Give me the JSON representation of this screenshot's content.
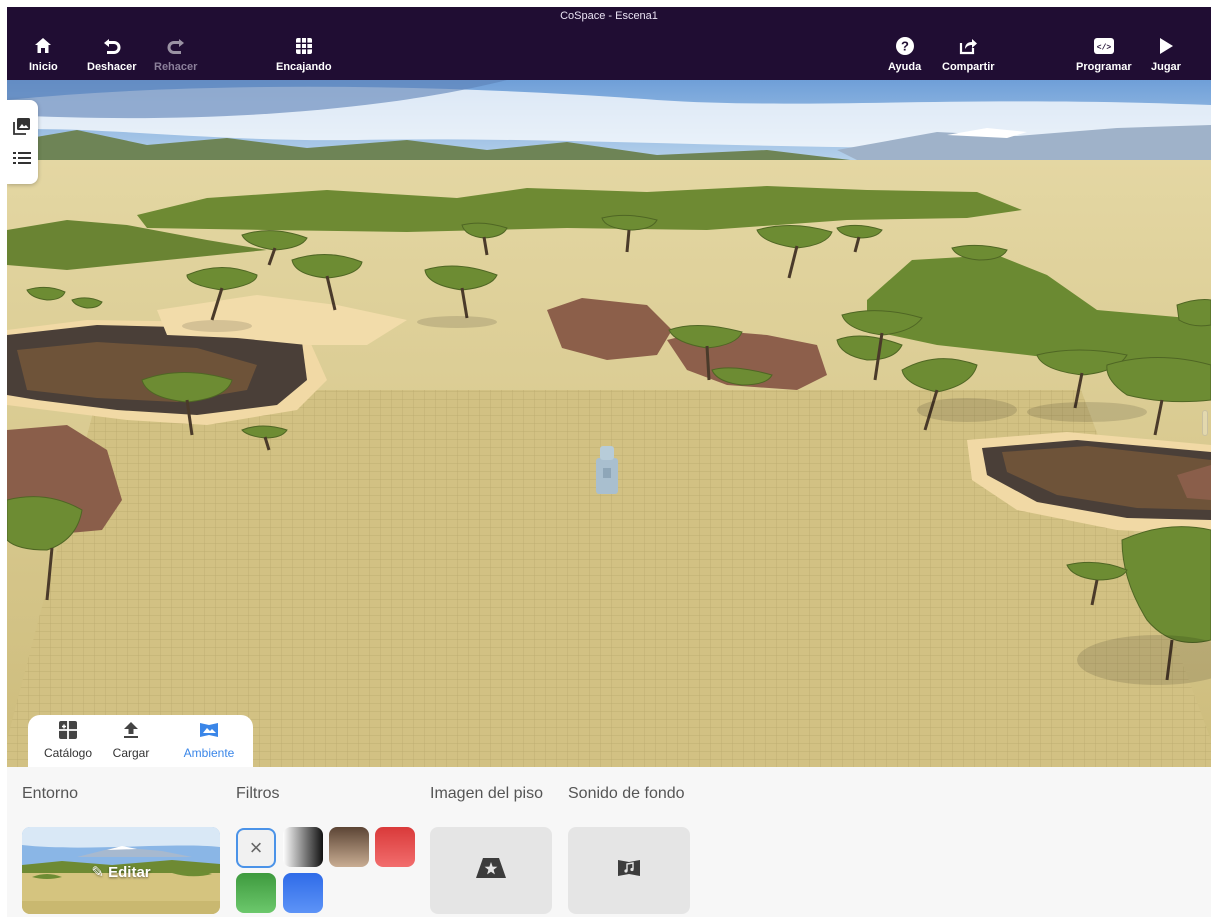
{
  "window": {
    "title": "CoSpace - Escena1"
  },
  "toolbar": {
    "home": {
      "label": "Inicio",
      "icon": "home-icon"
    },
    "undo": {
      "label": "Deshacer",
      "icon": "undo-icon"
    },
    "redo": {
      "label": "Rehacer",
      "icon": "redo-icon",
      "enabled": false
    },
    "snap": {
      "label": "Encajando",
      "icon": "grid-icon"
    },
    "help": {
      "label": "Ayuda",
      "icon": "help-icon"
    },
    "share": {
      "label": "Compartir",
      "icon": "share-icon"
    },
    "code": {
      "label": "Programar",
      "icon": "code-icon"
    },
    "play": {
      "label": "Jugar",
      "icon": "play-icon"
    }
  },
  "side_tools": [
    {
      "icon": "image-stack-icon"
    },
    {
      "icon": "list-icon"
    }
  ],
  "tabs": [
    {
      "label": "Catálogo",
      "icon": "catalog-icon",
      "active": false
    },
    {
      "label": "Cargar",
      "icon": "upload-icon",
      "active": false
    },
    {
      "label": "Ambiente",
      "icon": "environment-icon",
      "active": true
    }
  ],
  "environment": {
    "title": "Entorno",
    "edit_label": "Editar"
  },
  "filters": {
    "title": "Filtros",
    "options": [
      {
        "name": "none",
        "selected": true
      },
      {
        "name": "grayscale",
        "colors": [
          "#ffffff",
          "#111111"
        ]
      },
      {
        "name": "sepia",
        "colors": [
          "#5c4535",
          "#c9ad93"
        ]
      },
      {
        "name": "red",
        "colors": [
          "#d93a3a",
          "#f26d6d"
        ]
      },
      {
        "name": "green",
        "colors": [
          "#3e9a3e",
          "#6cc86c"
        ]
      },
      {
        "name": "blue",
        "colors": [
          "#2f6be8",
          "#5d93f7"
        ]
      }
    ]
  },
  "floor_image": {
    "title": "Imagen del piso",
    "icon": "floor-image-icon"
  },
  "background_sound": {
    "title": "Sonido de fondo",
    "icon": "music-icon"
  },
  "colors": {
    "topbar": "#200d33",
    "accent": "#3a86e8",
    "panel": "#f7f7f7"
  }
}
